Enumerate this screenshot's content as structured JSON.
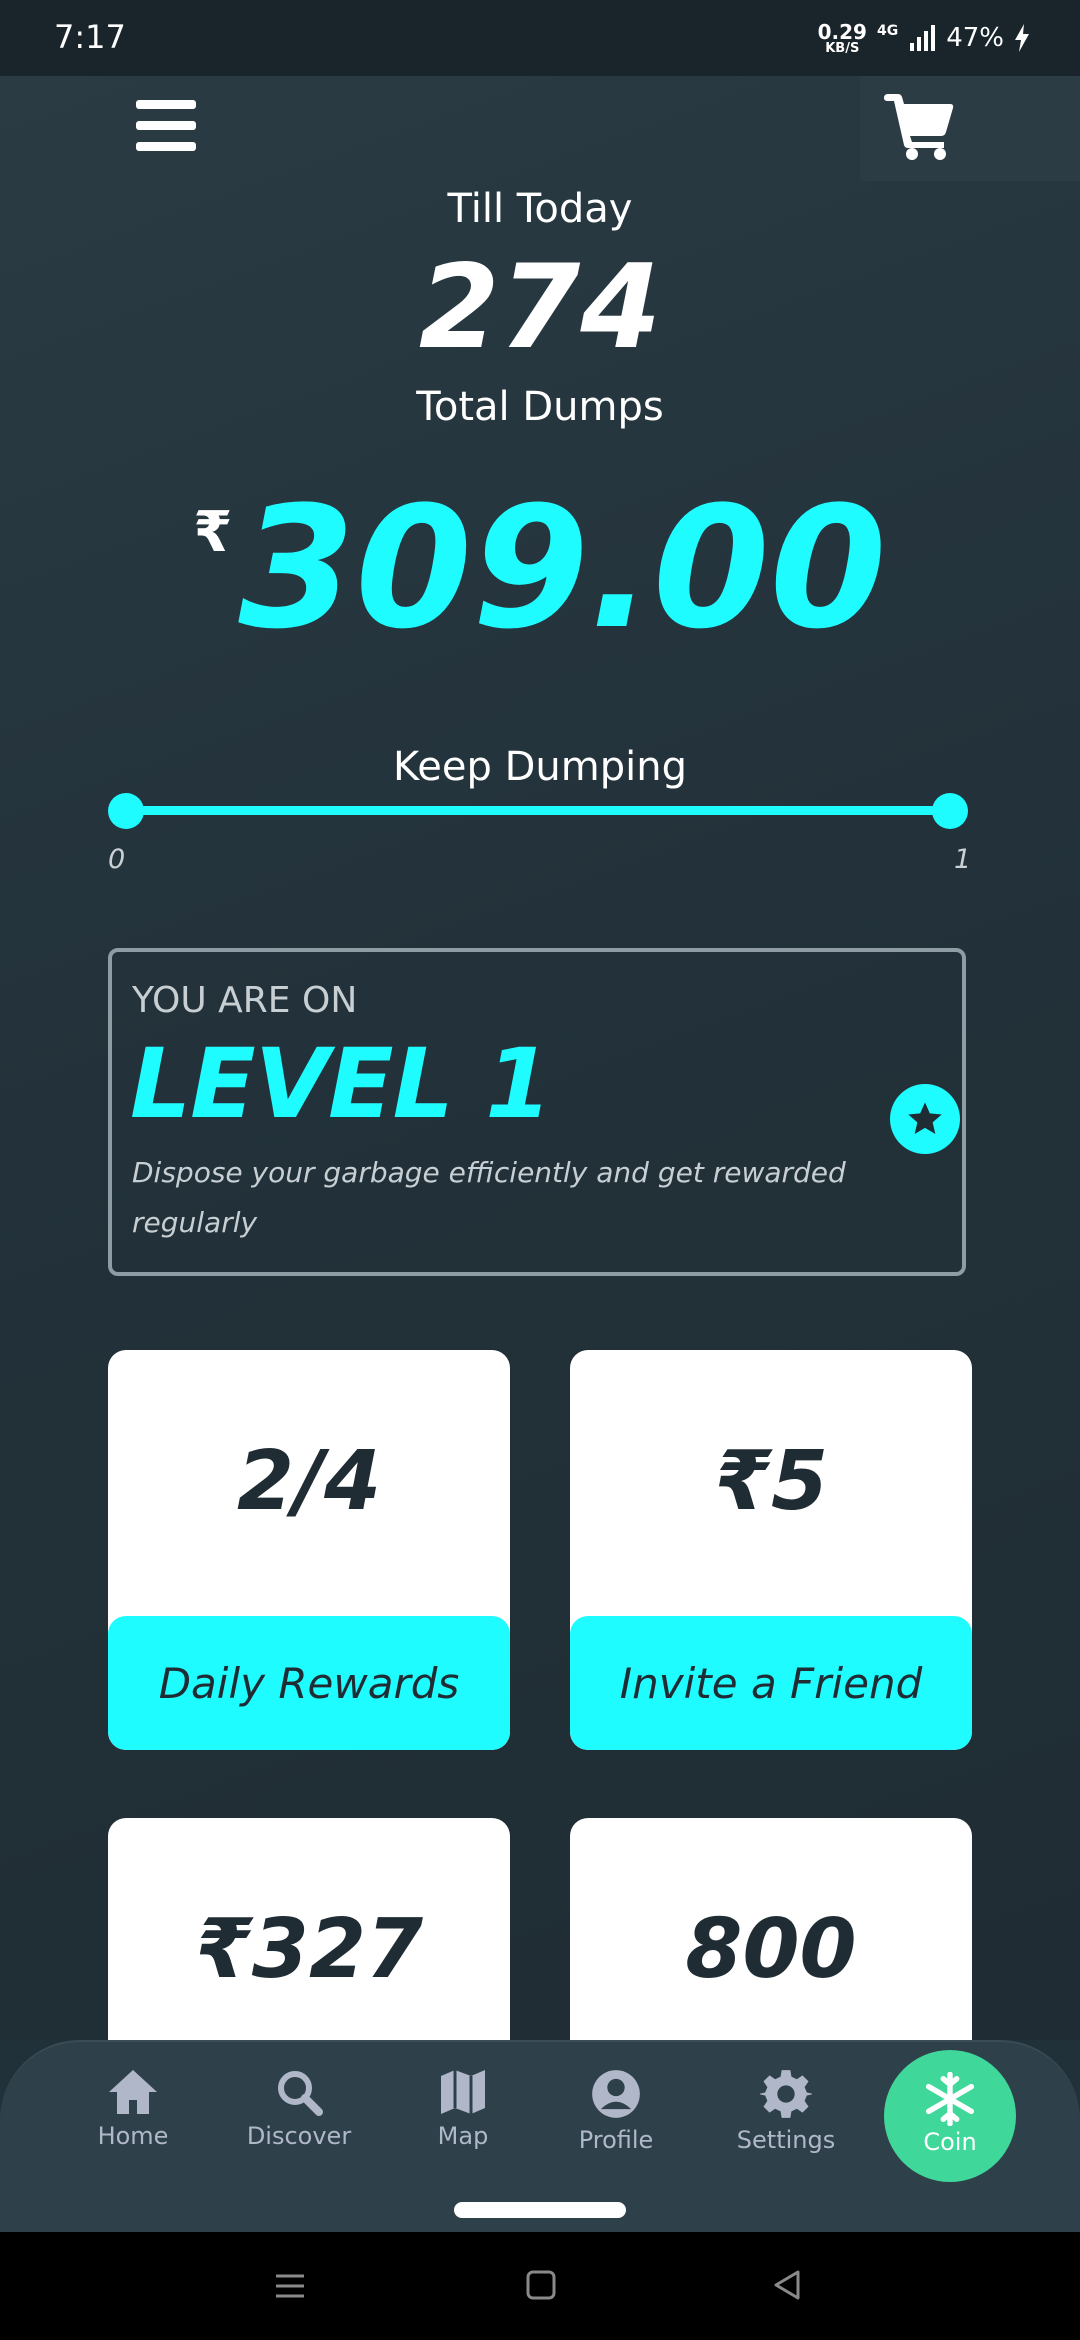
{
  "status_bar": {
    "time": "7:17",
    "net_speed_value": "0.29",
    "net_speed_unit": "KB/S",
    "network_type": "4G",
    "battery": "47%"
  },
  "header": {
    "menu_icon": "hamburger-menu-icon",
    "cart_icon": "shopping-cart-icon"
  },
  "summary": {
    "till_label": "Till Today",
    "total_dumps": "274",
    "total_label": "Total Dumps",
    "currency_symbol": "₹",
    "amount": "309.00"
  },
  "progress": {
    "label": "Keep Dumping",
    "min": "0",
    "max": "1",
    "value_fraction": 1.0
  },
  "level": {
    "pre_label": "YOU ARE ON",
    "title": "LEVEL 1",
    "description": "Dispose your garbage efficiently and get rewarded regularly",
    "icon": "star-icon"
  },
  "tiles": [
    {
      "value": "2/4",
      "button": "Daily Rewards"
    },
    {
      "value": "₹5",
      "button": "Invite a Friend"
    },
    {
      "value": "₹327",
      "button": ""
    },
    {
      "value": "800",
      "button": ""
    }
  ],
  "nav": {
    "items": [
      {
        "label": "Home",
        "icon": "home-icon"
      },
      {
        "label": "Discover",
        "icon": "search-icon"
      },
      {
        "label": "Map",
        "icon": "map-icon"
      },
      {
        "label": "Profile",
        "icon": "profile-icon"
      },
      {
        "label": "Settings",
        "icon": "gear-icon"
      },
      {
        "label": "Coin",
        "icon": "snowflake-icon"
      }
    ],
    "active": "Coin"
  },
  "colors": {
    "accent": "#1efcff",
    "background": "#23323a",
    "active_nav": "#3fd89a",
    "nav_inactive": "#b0b7c9"
  }
}
